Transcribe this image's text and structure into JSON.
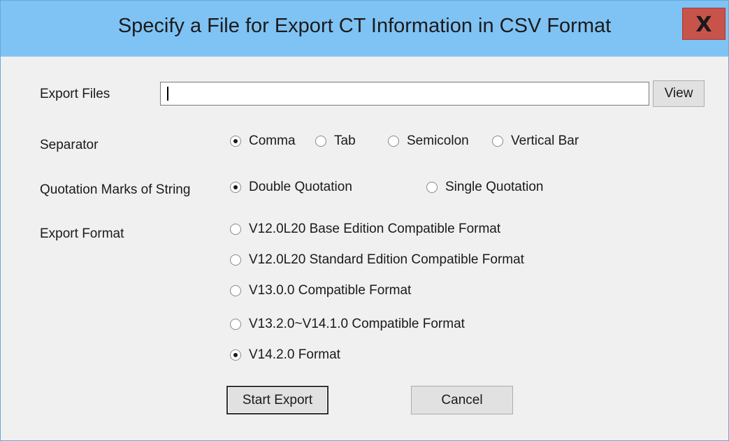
{
  "window": {
    "title": "Specify a File for Export CT Information in CSV Format",
    "close_label": "X"
  },
  "export_files": {
    "label": "Export Files",
    "value": "",
    "placeholder": "",
    "view_button": "View"
  },
  "separator": {
    "label": "Separator",
    "options": [
      {
        "label": "Comma",
        "checked": true
      },
      {
        "label": "Tab",
        "checked": false
      },
      {
        "label": "Semicolon",
        "checked": false
      },
      {
        "label": "Vertical Bar",
        "checked": false
      }
    ]
  },
  "quotation": {
    "label": "Quotation Marks of String",
    "options": [
      {
        "label": "Double Quotation",
        "checked": true
      },
      {
        "label": "Single Quotation",
        "checked": false
      }
    ]
  },
  "export_format": {
    "label": "Export Format",
    "options": [
      {
        "label": "V12.0L20 Base Edition Compatible Format",
        "checked": false
      },
      {
        "label": "V12.0L20 Standard Edition Compatible Format",
        "checked": false
      },
      {
        "label": "V13.0.0 Compatible Format",
        "checked": false
      },
      {
        "label": "V13.2.0~V14.1.0 Compatible Format",
        "checked": false
      },
      {
        "label": "V14.2.0 Format",
        "checked": true
      }
    ]
  },
  "actions": {
    "start_export": "Start Export",
    "cancel": "Cancel"
  },
  "colors": {
    "titlebar": "#7fc3f4",
    "close_button": "#c8534a",
    "dialog_background": "#f0f0f0"
  }
}
